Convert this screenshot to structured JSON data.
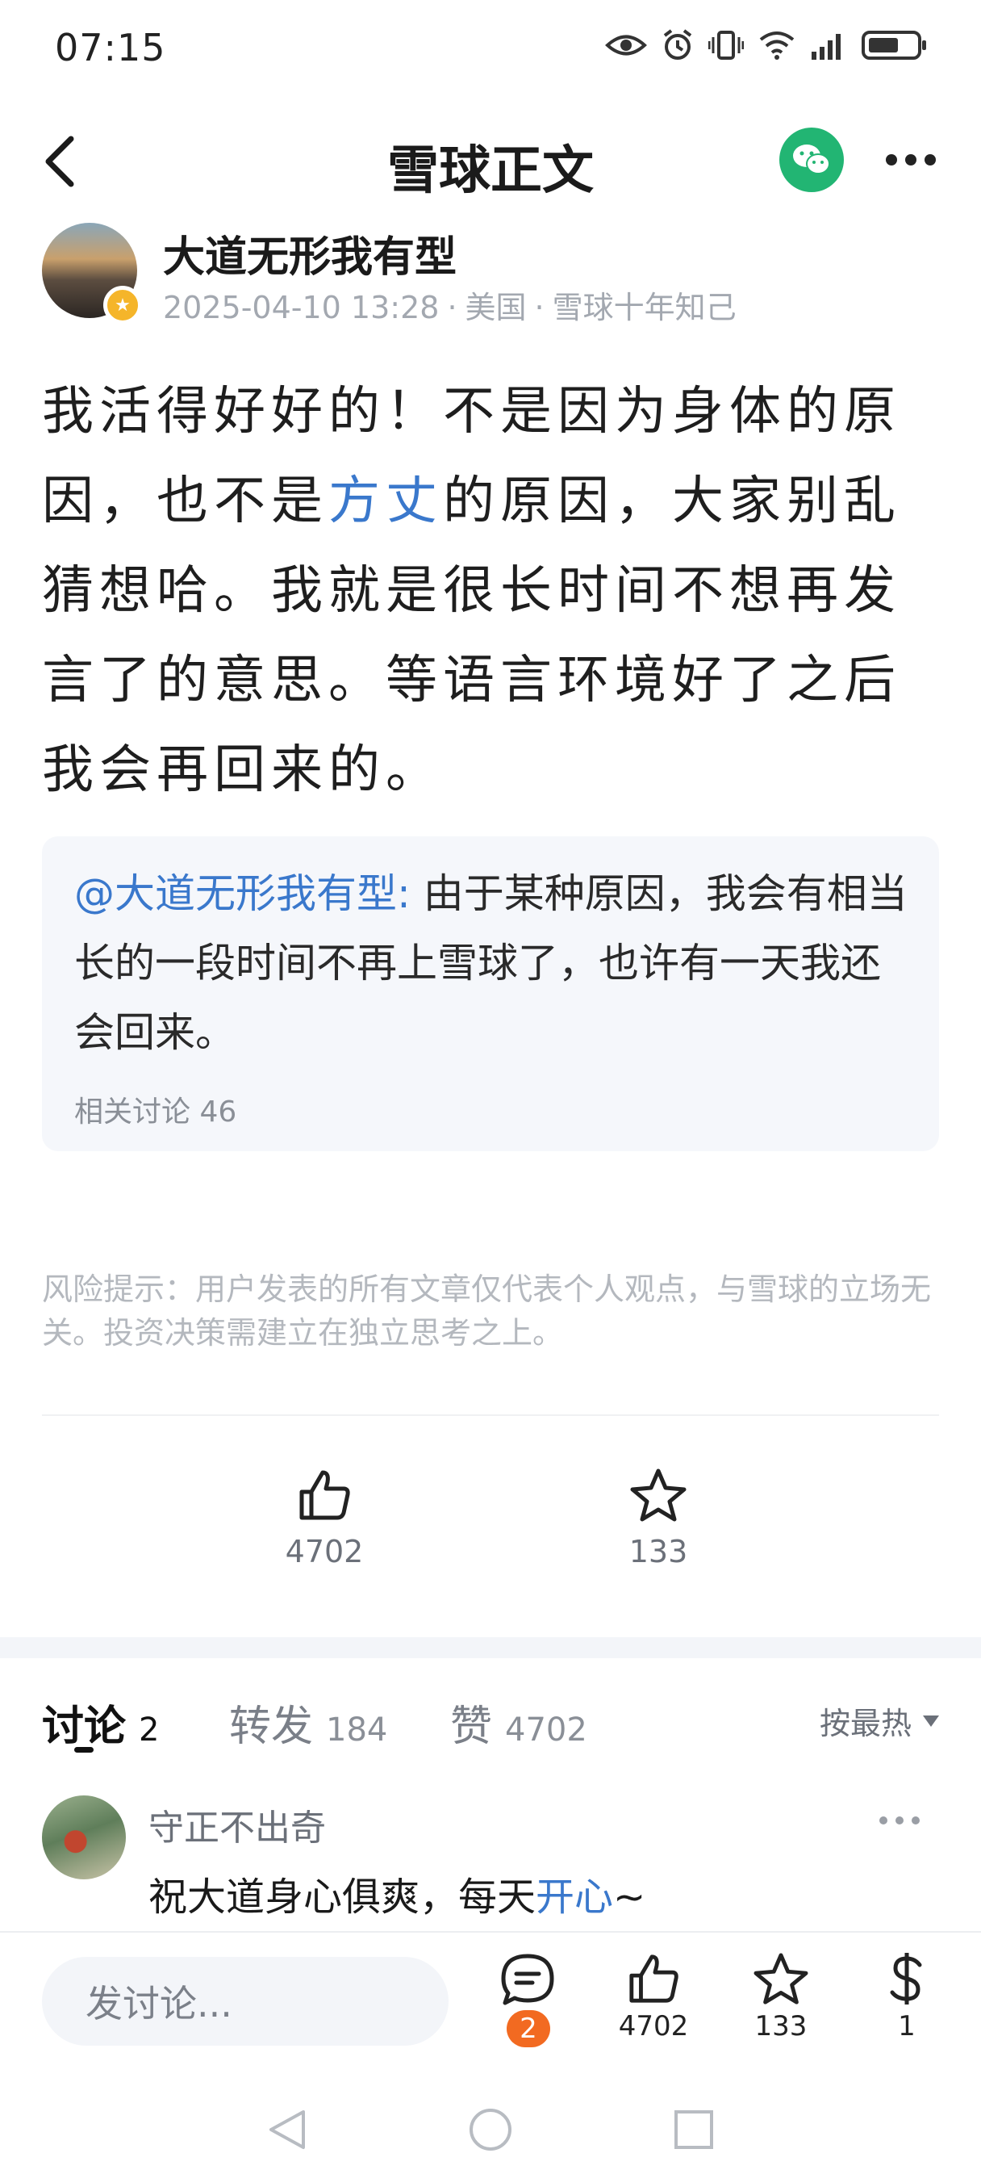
{
  "status_bar": {
    "time": "07:15"
  },
  "header": {
    "title": "雪球正文"
  },
  "author": {
    "name": "大道无形我有型",
    "time": "2025-04-10 13:28",
    "location": "美国",
    "tag": "雪球十年知己"
  },
  "post": {
    "part1": "我活得好好的！不是因为身体的原因，也不是",
    "link": "方丈",
    "part2": "的原因，大家别乱猜想哈。我就是很长时间不想再发言了的意思。等语言环境好了之后我会再回来的。"
  },
  "quote": {
    "mention": "@大道无形我有型:",
    "text": " 由于某种原因，我会有相当长的一段时间不再上雪球了，也许有一天我还会回来。",
    "related": "相关讨论 46"
  },
  "risk_notice": "风险提示：用户发表的所有文章仅代表个人观点，与雪球的立场无关。投资决策需建立在独立思考之上。",
  "stats": {
    "likes": "4702",
    "favorites": "133"
  },
  "tabs": [
    {
      "label": "讨论",
      "count": "2"
    },
    {
      "label": "转发",
      "count": "184"
    },
    {
      "label": "赞",
      "count": "4702"
    }
  ],
  "sort": {
    "label": "按最热"
  },
  "comment": {
    "user": "守正不出奇",
    "text_before": "祝大道身心俱爽，每天",
    "link": "开心",
    "text_after": "~"
  },
  "bottom_bar": {
    "input_placeholder": "发讨论...",
    "comments_badge": "2",
    "likes": "4702",
    "favorites": "133",
    "reward": "1"
  },
  "colors": {
    "accent": "#3a78cc",
    "wechat": "#22b573",
    "badge": "#f26a21"
  }
}
